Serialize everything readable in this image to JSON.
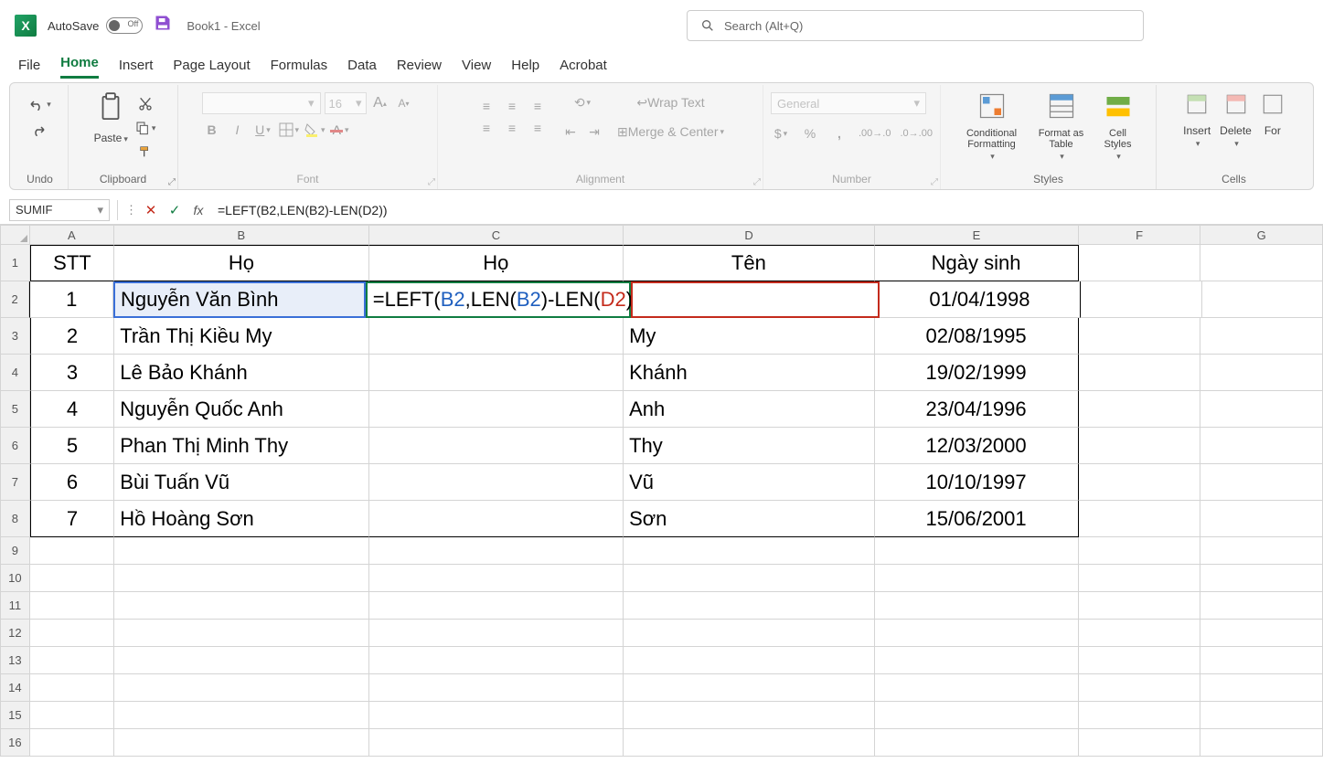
{
  "title": {
    "autosave": "AutoSave",
    "autosave_state": "Off",
    "doc": "Book1  -  Excel"
  },
  "search": {
    "placeholder": "Search (Alt+Q)"
  },
  "tabs": [
    "File",
    "Home",
    "Insert",
    "Page Layout",
    "Formulas",
    "Data",
    "Review",
    "View",
    "Help",
    "Acrobat"
  ],
  "ribbon": {
    "undo": "Undo",
    "clipboard": {
      "title": "Clipboard",
      "paste": "Paste"
    },
    "font": {
      "title": "Font",
      "size": "16"
    },
    "alignment": {
      "title": "Alignment",
      "wrap": "Wrap Text",
      "merge": "Merge & Center"
    },
    "number": {
      "title": "Number",
      "format": "General"
    },
    "styles": {
      "title": "Styles",
      "cond": "Conditional Formatting",
      "fmt": "Format as Table",
      "cell": "Cell Styles"
    },
    "cells": {
      "title": "Cells",
      "insert": "Insert",
      "delete": "Delete",
      "format": "For"
    }
  },
  "formula_bar": {
    "name_box": "SUMIF",
    "formula": "=LEFT(B2,LEN(B2)-LEN(D2))"
  },
  "columns": [
    "A",
    "B",
    "C",
    "D",
    "E",
    "F",
    "G"
  ],
  "headers": {
    "A": "STT",
    "B": "Họ",
    "C": "Họ",
    "D": "Tên",
    "E": "Ngày sinh"
  },
  "rows": [
    {
      "stt": "1",
      "ho": "Nguyễn Văn Bình",
      "c_formula": {
        "pre": "=LEFT(",
        "b": "B2",
        "mid1": ",LEN(",
        "b2": "B2",
        "mid2": ")-LEN(",
        "d": "D2",
        "post": "))"
      },
      "ten": "",
      "ngay": "01/04/1998"
    },
    {
      "stt": "2",
      "ho": "Trần Thị Kiều My",
      "c": "",
      "ten": "My",
      "ngay": "02/08/1995"
    },
    {
      "stt": "3",
      "ho": "Lê Bảo Khánh",
      "c": "",
      "ten": "Khánh",
      "ngay": "19/02/1999"
    },
    {
      "stt": "4",
      "ho": "Nguyễn Quốc Anh",
      "c": "",
      "ten": "Anh",
      "ngay": "23/04/1996"
    },
    {
      "stt": "5",
      "ho": "Phan Thị Minh Thy",
      "c": "",
      "ten": "Thy",
      "ngay": "12/03/2000"
    },
    {
      "stt": "6",
      "ho": "Bùi Tuấn Vũ",
      "c": "",
      "ten": "Vũ",
      "ngay": "10/10/1997"
    },
    {
      "stt": "7",
      "ho": "Hồ Hoàng Sơn",
      "c": "",
      "ten": "Sơn",
      "ngay": "15/06/2001"
    }
  ]
}
